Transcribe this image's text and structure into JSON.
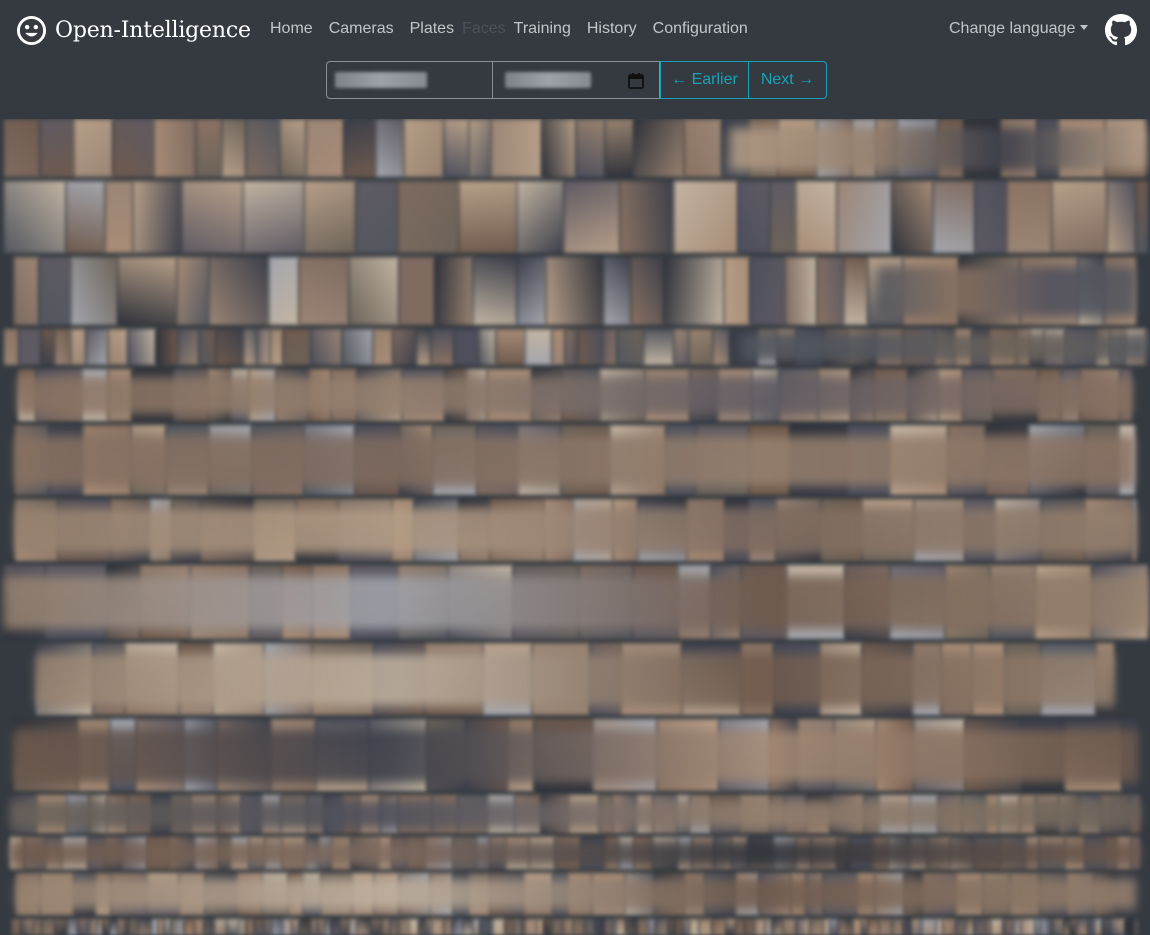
{
  "app": {
    "name": "Open-Intelligence"
  },
  "nav": {
    "items": [
      {
        "label": "Home",
        "state": "normal"
      },
      {
        "label": "Cameras",
        "state": "normal"
      },
      {
        "label": "Plates",
        "state": "normal"
      },
      {
        "label": "Faces",
        "state": "active"
      },
      {
        "label": "Training",
        "state": "normal"
      },
      {
        "label": "History",
        "state": "normal"
      },
      {
        "label": "Configuration",
        "state": "normal"
      }
    ],
    "language_label": "Change language"
  },
  "controls": {
    "earlier_label": "← Earlier",
    "next_label": "Next →"
  },
  "colors": {
    "background": "#343a40",
    "accent": "#17a2b8",
    "nav_text": "#b3b6b9",
    "brand_text": "#ffffff"
  },
  "icons": {
    "brand": "smiley-face-icon",
    "github": "github-icon",
    "calendar": "calendar-icon",
    "dropdown": "caret-down-icon"
  }
}
